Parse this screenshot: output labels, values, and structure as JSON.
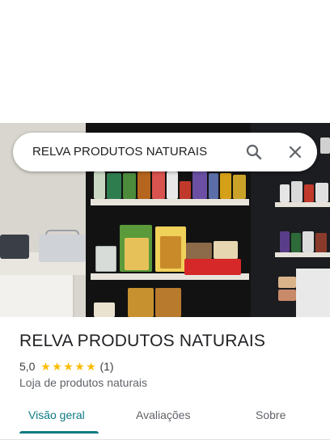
{
  "search": {
    "query": "RELVA PRODUTOS NATURAIS",
    "search_icon": "search-icon",
    "close_icon": "close-icon"
  },
  "place": {
    "name": "RELVA PRODUTOS NATURAIS",
    "rating": "5,0",
    "stars_filled": 5,
    "stars_total": 5,
    "review_count": "(1)",
    "category": "Loja de produtos naturais"
  },
  "tabs": [
    {
      "label": "Visão geral",
      "active": true
    },
    {
      "label": "Avaliações",
      "active": false
    },
    {
      "label": "Sobre",
      "active": false
    }
  ],
  "colors": {
    "accent": "#0b7a83",
    "star": "#fbbc04"
  }
}
